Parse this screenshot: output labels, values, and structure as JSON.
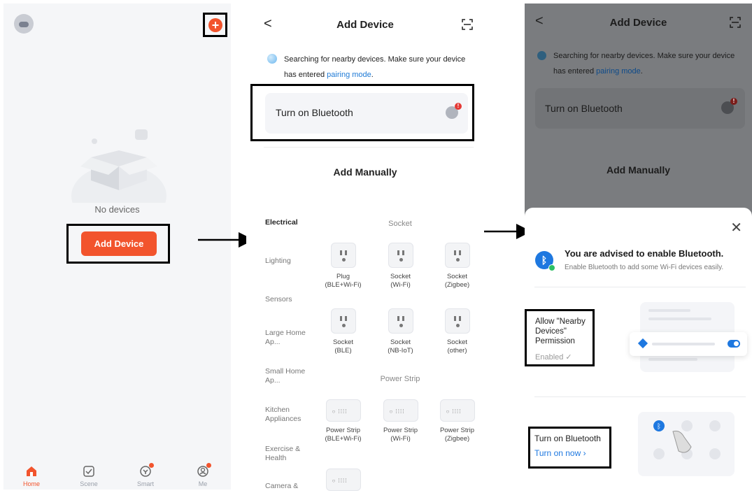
{
  "screen1": {
    "empty_state_text": "No devices",
    "add_device_label": "Add Device",
    "plus_symbol": "+",
    "tabs": [
      {
        "label": "Home",
        "icon": "home-icon"
      },
      {
        "label": "Scene",
        "icon": "scene-icon"
      },
      {
        "label": "Smart",
        "icon": "smart-icon"
      },
      {
        "label": "Me",
        "icon": "me-icon"
      }
    ]
  },
  "screen2": {
    "back_symbol": "<",
    "title": "Add Device",
    "search_text": "Searching for nearby devices. Make sure your device has entered",
    "search_link": "pairing mode",
    "search_tail": ".",
    "bluetooth_card_label": "Turn on Bluetooth",
    "badge": "!",
    "add_manually": "Add Manually",
    "categories": [
      "Electrical",
      "Lighting",
      "Sensors",
      "Large Home Ap...",
      "Small Home Ap...",
      "Kitchen Appliances",
      "Exercise & Health",
      "Camera &"
    ],
    "section_socket": "Socket",
    "section_strip": "Power Strip",
    "devices": [
      {
        "name": "Plug",
        "sub": "(BLE+Wi-Fi)"
      },
      {
        "name": "Socket",
        "sub": "(Wi-Fi)"
      },
      {
        "name": "Socket",
        "sub": "(Zigbee)"
      },
      {
        "name": "Socket",
        "sub": "(BLE)"
      },
      {
        "name": "Socket",
        "sub": "(NB-IoT)"
      },
      {
        "name": "Socket",
        "sub": "(other)"
      },
      {
        "name": "Power Strip",
        "sub": "(BLE+Wi-Fi)"
      },
      {
        "name": "Power Strip",
        "sub": "(Wi-Fi)"
      },
      {
        "name": "Power Strip",
        "sub": "(Zigbee)"
      }
    ]
  },
  "screen3": {
    "back_symbol": "<",
    "title": "Add Device",
    "search_text": "Searching for nearby devices. Make sure your device has entered",
    "search_link": "pairing mode",
    "search_tail": ".",
    "bluetooth_card_label": "Turn on Bluetooth",
    "badge": "!",
    "add_manually": "Add Manually",
    "close_symbol": "✕",
    "advice_title": "You are advised to enable Bluetooth.",
    "advice_subtitle": "Enable Bluetooth to add some Wi-Fi devices easily.",
    "permission_label": "Allow \"Nearby Devices\" Permission",
    "permission_status": "Enabled ✓",
    "turn_on_label": "Turn on Bluetooth",
    "turn_on_now": "Turn on now ›"
  }
}
